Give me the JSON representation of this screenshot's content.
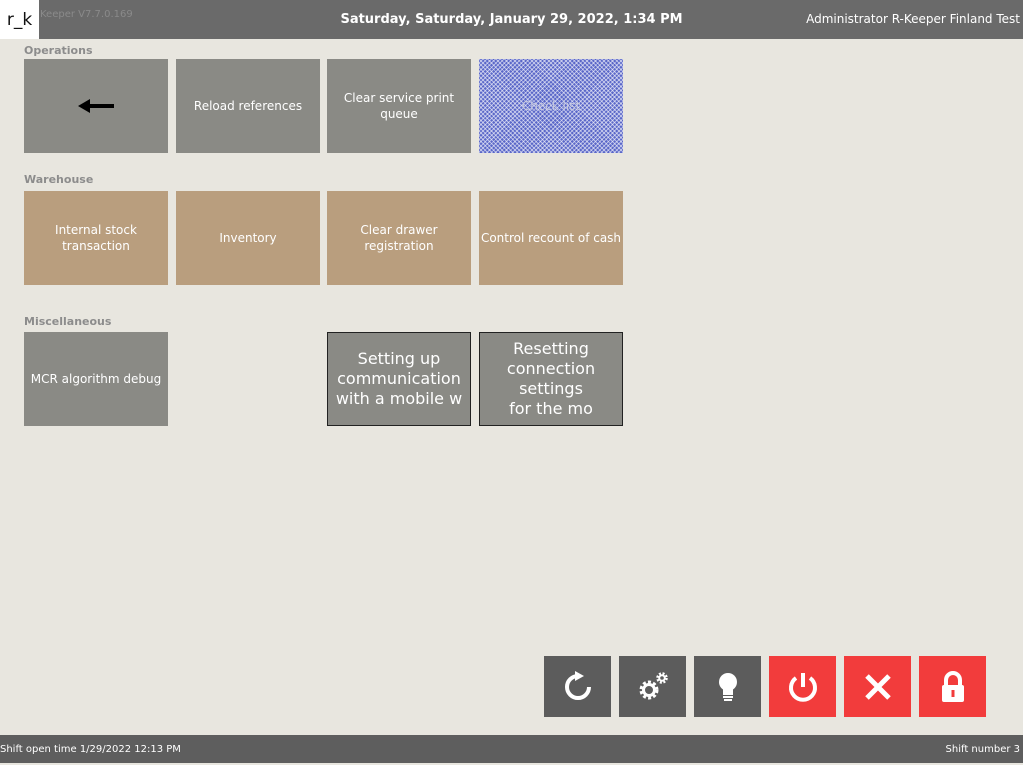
{
  "header": {
    "logo": "r_k",
    "version": "Keeper V7.7.0.169",
    "datetime": "Saturday, Saturday, January 29, 2022, 1:34 PM",
    "user": "Administrator R-Keeper Finland Test"
  },
  "sections": {
    "operations": "Operations",
    "warehouse": "Warehouse",
    "miscellaneous": "Miscellaneous"
  },
  "operations": {
    "back_icon": "left-arrow-icon",
    "reload": "Reload references",
    "clear_print_queue": "Clear service print queue",
    "check_list": "Check list"
  },
  "warehouse": {
    "internal_stock_1": "Internal stock",
    "internal_stock_2": "transaction",
    "inventory": "Inventory",
    "clear_drawer_1": "Clear drawer",
    "clear_drawer_2": "registration",
    "control_recount": "Control recount of cash"
  },
  "misc": {
    "mcr_debug": "MCR algorithm debug",
    "setup_mobile_1": "Setting up",
    "setup_mobile_2": "communication",
    "setup_mobile_3": "with a mobile w",
    "reset_conn_1": "Resetting",
    "reset_conn_2": "connection settings",
    "reset_conn_3": "for the mo"
  },
  "actions": [
    {
      "icon": "refresh-icon"
    },
    {
      "icon": "gears-icon"
    },
    {
      "icon": "lightbulb-icon"
    },
    {
      "icon": "power-icon"
    },
    {
      "icon": "close-icon"
    },
    {
      "icon": "lock-icon"
    }
  ],
  "colors": {
    "gray_tile": "#8a8a85",
    "tan_tile": "#b99e7e",
    "action_red": "#f23c3c",
    "action_dark": "#5c5c5c",
    "disabled_pattern": "#5a67c8"
  },
  "footer": {
    "shift_open": "Shift open time 1/29/2022 12:13 PM",
    "shift_number": "Shift number 3"
  }
}
